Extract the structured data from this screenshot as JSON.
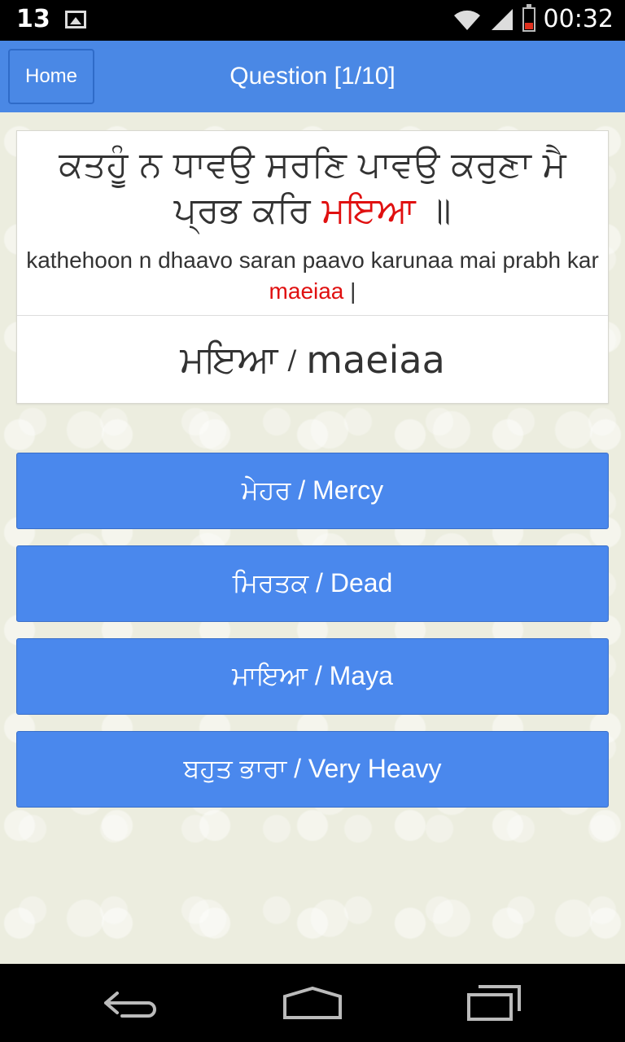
{
  "status_bar": {
    "notification_count": "13",
    "time": "00:32"
  },
  "header": {
    "home_label": "Home",
    "title": "Question [1/10]"
  },
  "question": {
    "gurmukhi_before": "ਕਤਹੂੰ ਨ ਧਾਵਉ ਸਰਣਿ ਪਾਵਉ ਕਰੁਣਾ ਮੈ ਪ੍ਰਭ ਕਰਿ ",
    "gurmukhi_highlight": "ਮਇਆ",
    "gurmukhi_after": " ॥",
    "translit_before": "kathehoon n dhaavo saran paavo karunaa mai prabh kar ",
    "translit_highlight": "maeiaa",
    "translit_after": " |",
    "word_gurmukhi": "ਮਇਆ",
    "word_separator": "/",
    "word_roman": "maeiaa",
    "highlight_color": "#e01010"
  },
  "options": [
    {
      "label": "ਮੇਹਰ / Mercy"
    },
    {
      "label": "ਮਿਰਤਕ / Dead"
    },
    {
      "label": "ਮਾਇਆ / Maya"
    },
    {
      "label": "ਬਹੁਤ ਭਾਰਾ / Very Heavy"
    }
  ],
  "colors": {
    "accent": "#4a88e5",
    "button": "#4a88ed"
  },
  "nav_bar": {
    "icons": [
      "back-icon",
      "home-icon",
      "recents-icon"
    ]
  }
}
